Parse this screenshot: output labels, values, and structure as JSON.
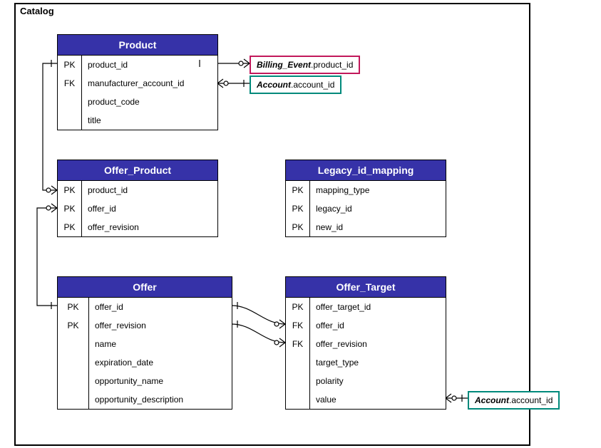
{
  "container": {
    "label": "Catalog"
  },
  "entities": {
    "product": {
      "title": "Product",
      "rows": [
        {
          "key": "PK",
          "name": "product_id"
        },
        {
          "key": "FK",
          "name": "manufacturer_account_id"
        },
        {
          "key": "",
          "name": "product_code"
        },
        {
          "key": "",
          "name": "title"
        }
      ]
    },
    "offer_product": {
      "title": "Offer_Product",
      "rows": [
        {
          "key": "PK",
          "name": "product_id"
        },
        {
          "key": "PK",
          "name": "offer_id"
        },
        {
          "key": "PK",
          "name": "offer_revision"
        }
      ]
    },
    "legacy_id_mapping": {
      "title": "Legacy_id_mapping",
      "rows": [
        {
          "key": "PK",
          "name": "mapping_type"
        },
        {
          "key": "PK",
          "name": "legacy_id"
        },
        {
          "key": "PK",
          "name": "new_id"
        }
      ]
    },
    "offer": {
      "title": "Offer",
      "rows": [
        {
          "key": "PK",
          "name": "offer_id"
        },
        {
          "key": "PK",
          "name": "offer_revision"
        },
        {
          "key": "",
          "name": "name"
        },
        {
          "key": "",
          "name": "expiration_date"
        },
        {
          "key": "",
          "name": "opportunity_name"
        },
        {
          "key": "",
          "name": "opportunity_description"
        }
      ]
    },
    "offer_target": {
      "title": "Offer_Target",
      "rows": [
        {
          "key": "PK",
          "name": "offer_target_id"
        },
        {
          "key": "FK",
          "name": "offer_id"
        },
        {
          "key": "FK",
          "name": "offer_revision"
        },
        {
          "key": "",
          "name": "target_type"
        },
        {
          "key": "",
          "name": "polarity"
        },
        {
          "key": "",
          "name": "value"
        }
      ]
    }
  },
  "refs": {
    "billing_event": {
      "table": "Billing_Event",
      "col": ".product_id"
    },
    "account1": {
      "table": "Account",
      "col": ".account_id"
    },
    "account2": {
      "table": "Account",
      "col": ".account_id"
    }
  }
}
